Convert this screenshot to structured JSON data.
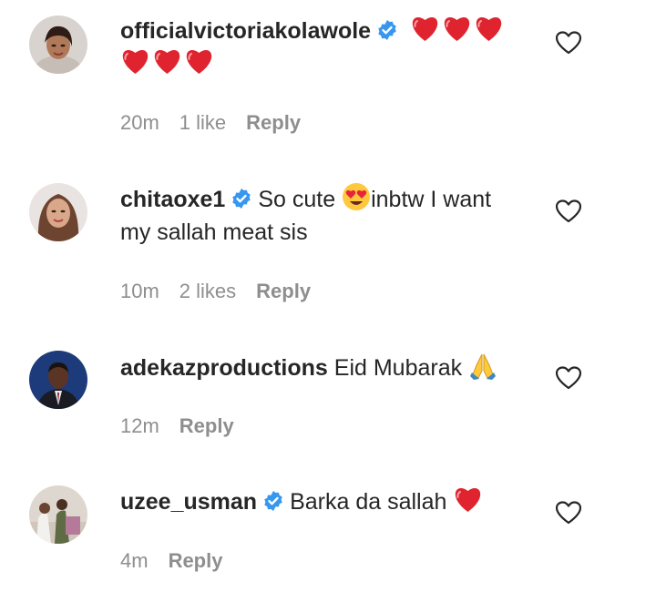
{
  "comments": [
    {
      "username": "officialvictoriakolawole",
      "verified": true,
      "text": "",
      "text_after_emoji": "",
      "emoji": [
        "red-heart",
        "red-heart",
        "red-heart",
        "red-heart",
        "red-heart",
        "red-heart"
      ],
      "time": "20m",
      "likes": "1 like",
      "reply_label": "Reply"
    },
    {
      "username": "chitaoxe1",
      "verified": true,
      "text": "So cute ",
      "text_after_emoji": "inbtw I want my sallah meat sis",
      "emoji": [
        "heart-eyes-face"
      ],
      "time": "10m",
      "likes": "2 likes",
      "reply_label": "Reply"
    },
    {
      "username": "adekazproductions",
      "verified": false,
      "text": "Eid Mubarak ",
      "text_after_emoji": "",
      "emoji": [
        "folded-hands"
      ],
      "time": "12m",
      "likes": "",
      "reply_label": "Reply"
    },
    {
      "username": "uzee_usman",
      "verified": true,
      "text": "Barka da sallah ",
      "text_after_emoji": "",
      "emoji": [
        "red-heart"
      ],
      "time": "4m",
      "likes": "",
      "reply_label": "Reply"
    }
  ],
  "colors": {
    "text": "#262626",
    "meta": "#8e8e8e",
    "verified": "#3797f0",
    "heart": "#e0242f"
  }
}
